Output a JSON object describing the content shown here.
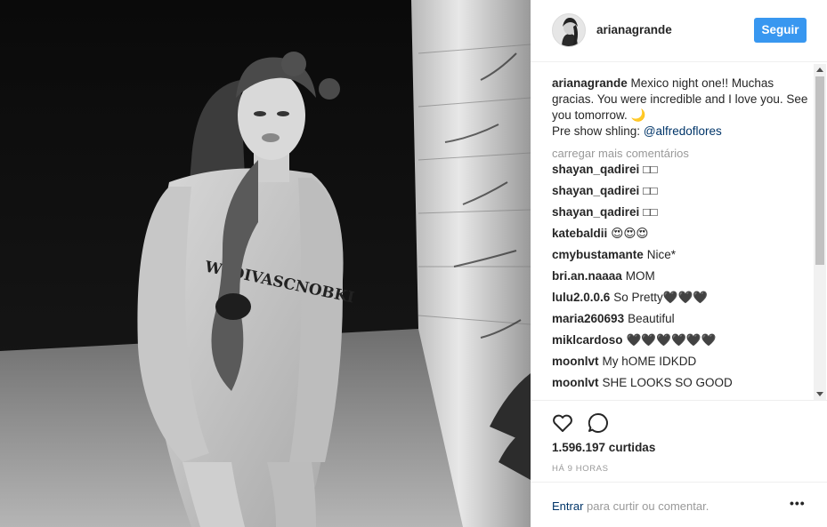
{
  "post": {
    "username": "arianagrande",
    "follow_label": "Seguir",
    "caption_user": "arianagrande",
    "caption_text": " Mexico night one!! Muchas gracias. You were incredible and I love you. See you tomorrow. 🌙",
    "caption_text2": "Pre show shling: ",
    "caption_mention": "@alfredoflores",
    "load_more_label": "carregar mais comentários",
    "comments": [
      {
        "user": "shayan_qadirei",
        "text": "□□"
      },
      {
        "user": "shayan_qadirei",
        "text": "□□"
      },
      {
        "user": "shayan_qadirei",
        "text": "□□"
      },
      {
        "user": "katebaldii",
        "text": "😍😍😍"
      },
      {
        "user": "cmybustamante",
        "text": "Nice*"
      },
      {
        "user": "bri.an.naaaa",
        "text": "MOM"
      },
      {
        "user": "lulu2.0.0.6",
        "text": "So Pretty🖤🖤🖤"
      },
      {
        "user": "maria260693",
        "text": "Beautiful"
      },
      {
        "user": "miklcardoso",
        "text": "🖤🖤🖤🖤🖤🖤"
      },
      {
        "user": "moonlvt",
        "text": "My hOME IDKDD"
      },
      {
        "user": "moonlvt",
        "text": "SHE LOOKS SO GOOD"
      }
    ],
    "likes": "1.596.197 curtidas",
    "time_ago": "HÁ 9 HORAS",
    "footer_login": "Entrar",
    "footer_text": " para curtir ou comentar.",
    "more_options": "•••"
  },
  "icons": {
    "like": "heart-icon",
    "comment": "comment-icon",
    "more": "more-options-icon"
  },
  "colors": {
    "accent": "#3897f0",
    "link": "#003569",
    "muted": "#999999"
  }
}
